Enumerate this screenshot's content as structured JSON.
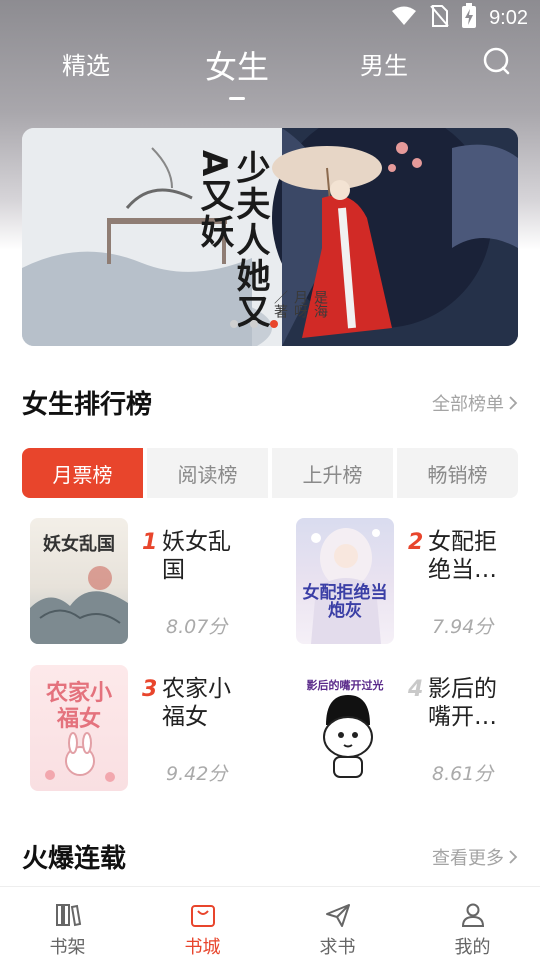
{
  "status_bar": {
    "time": "9:02"
  },
  "top_nav": {
    "tabs": [
      {
        "label": "精选"
      },
      {
        "label": "女生"
      },
      {
        "label": "男生"
      }
    ]
  },
  "banner": {
    "title": "少夫人她又A又妖",
    "author": "是海月呀／著",
    "dot_count": 3
  },
  "ranking": {
    "title": "女生排行榜",
    "more": "全部榜单",
    "tabs": [
      "月票榜",
      "阅读榜",
      "上升榜",
      "畅销榜"
    ],
    "books": [
      {
        "rank": "1",
        "name": "妖女乱国",
        "score": "8.07分",
        "cover_text": "妖女乱国"
      },
      {
        "rank": "2",
        "name": "女配拒绝当…",
        "score": "7.94分",
        "cover_text": "女配拒绝当炮灰"
      },
      {
        "rank": "3",
        "name": "农家小福女",
        "score": "9.42分",
        "cover_text": "农家小福女"
      },
      {
        "rank": "4",
        "name": "影后的嘴开…",
        "score": "8.61分",
        "cover_text": "影后的嘴开过光"
      }
    ]
  },
  "serial": {
    "title": "火爆连载",
    "more": "查看更多"
  },
  "tab_bar": {
    "items": [
      {
        "label": "书架",
        "icon": "bookshelf-icon"
      },
      {
        "label": "书城",
        "icon": "bookstore-icon"
      },
      {
        "label": "求书",
        "icon": "paper-plane-icon"
      },
      {
        "label": "我的",
        "icon": "person-icon"
      }
    ]
  },
  "colors": {
    "accent": "#e8452c"
  }
}
